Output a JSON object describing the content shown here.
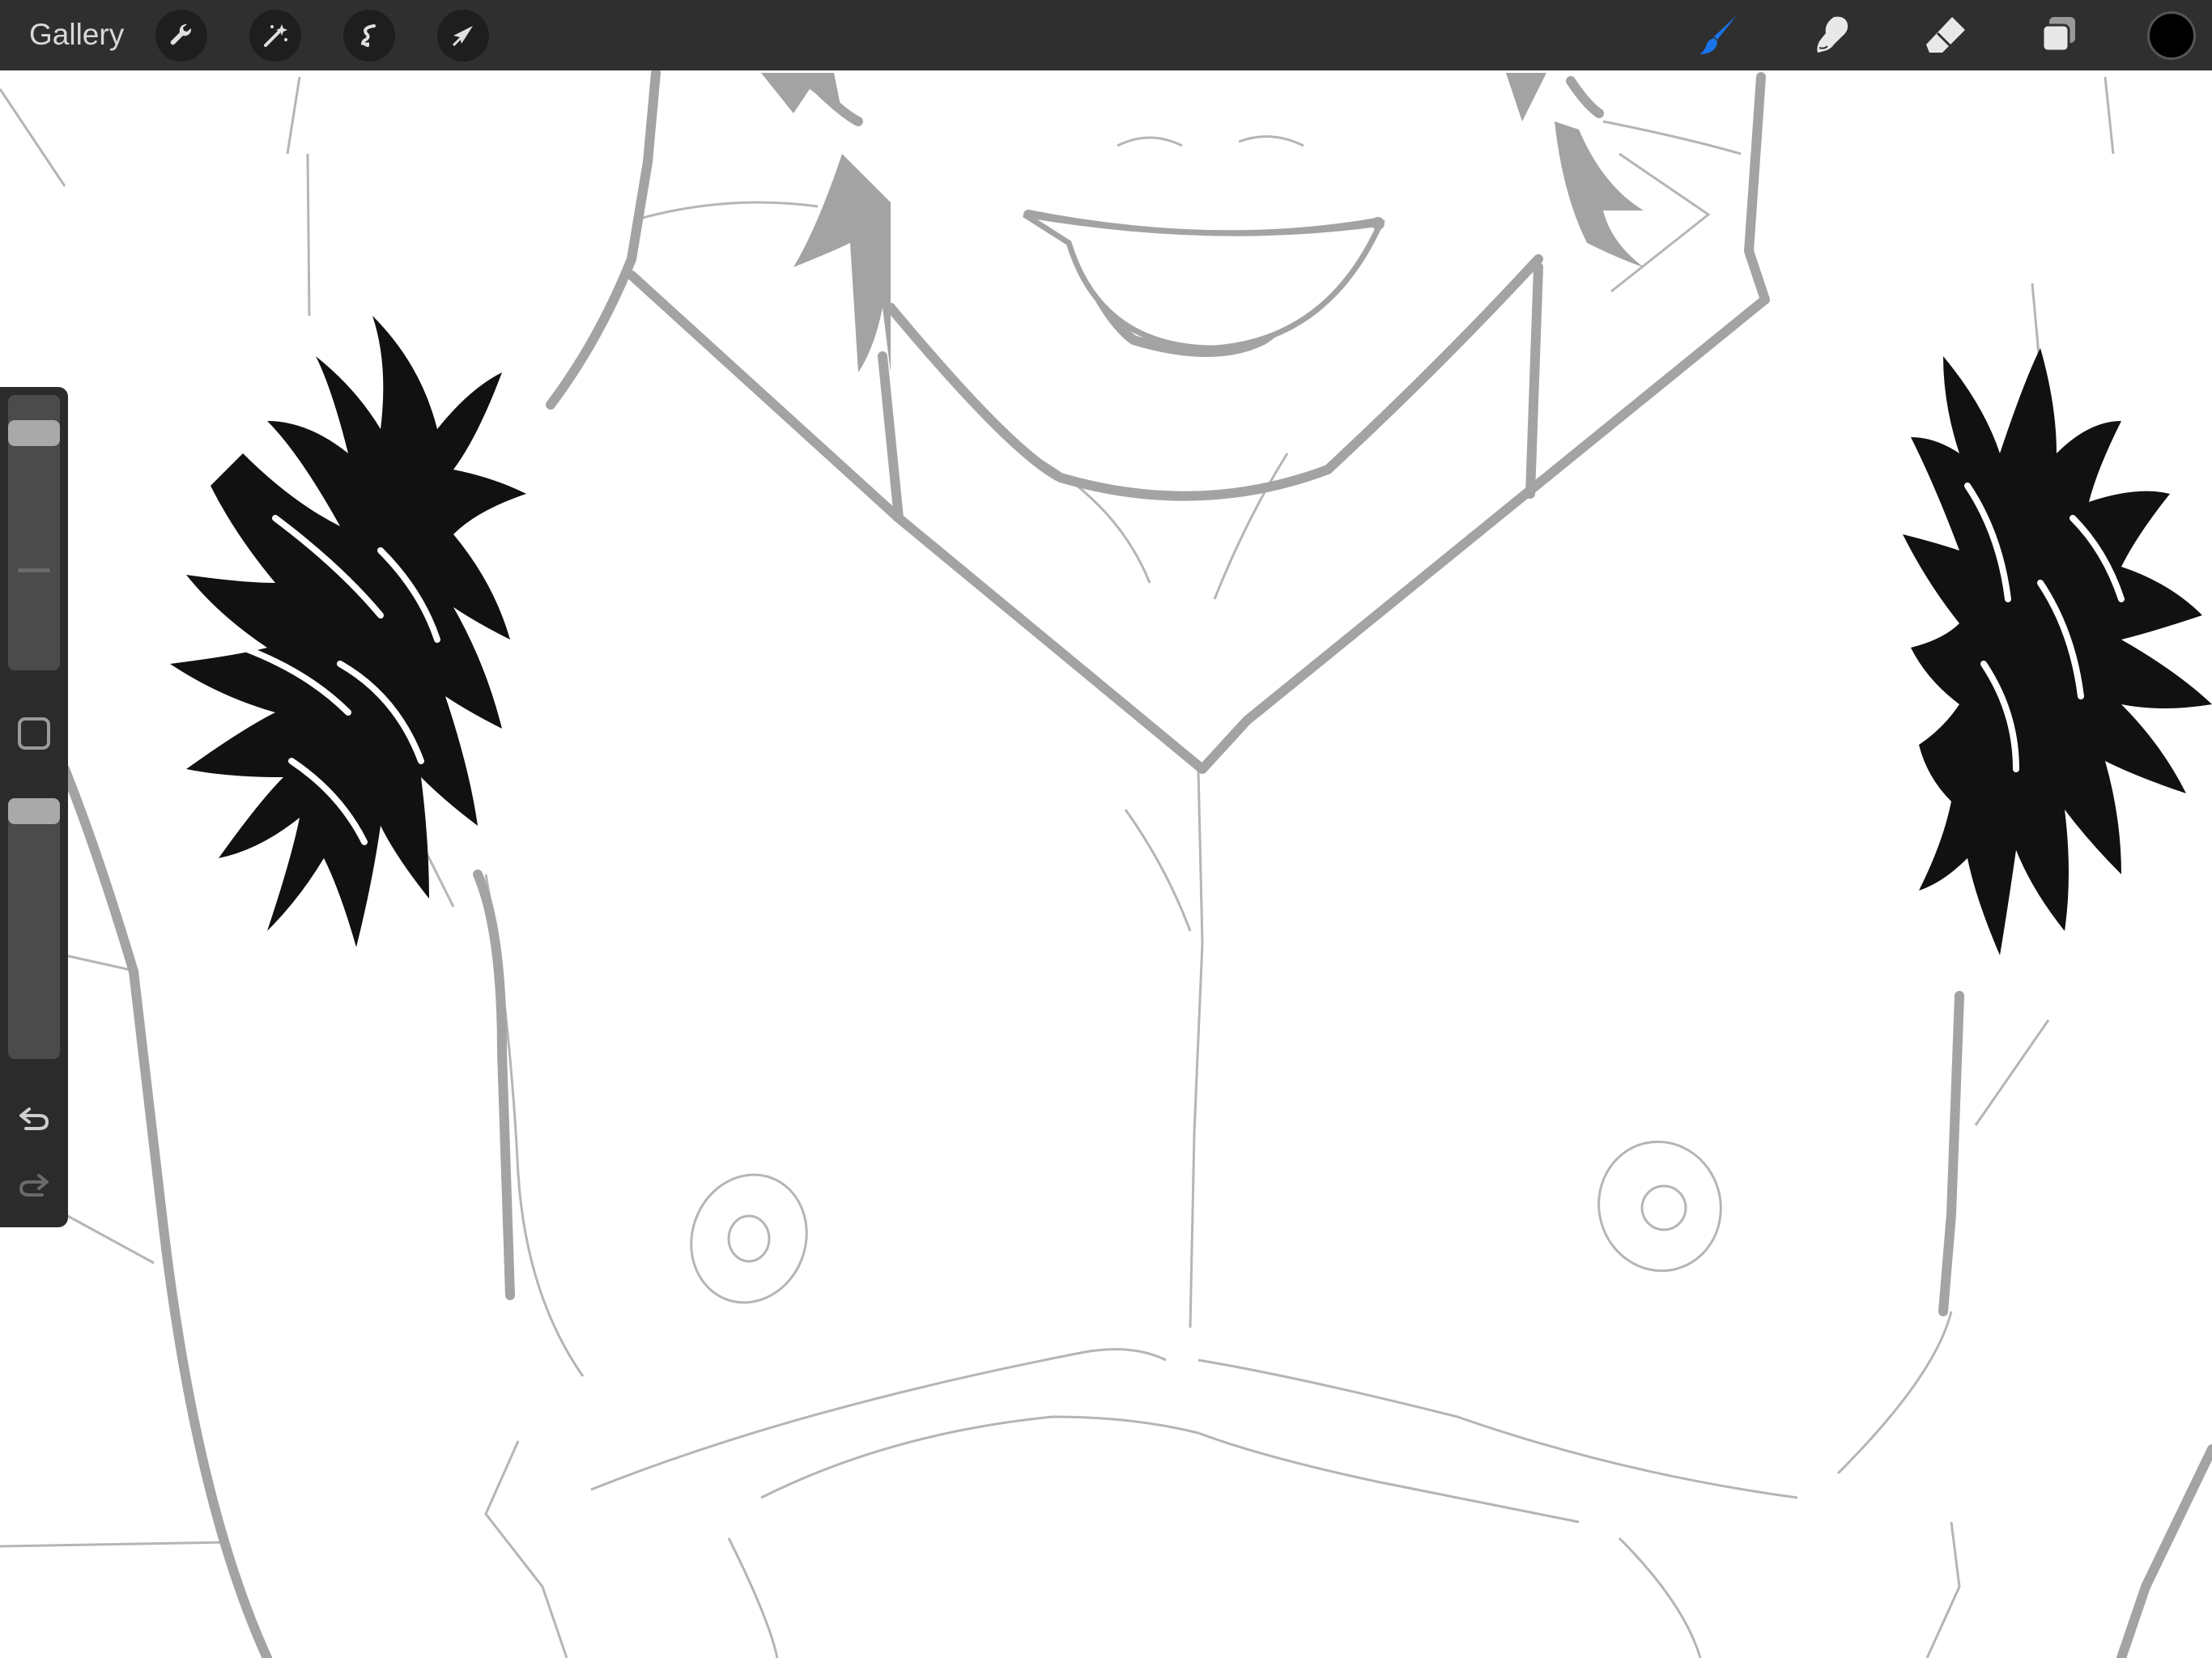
{
  "toolbar": {
    "gallery_label": "Gallery",
    "left_tools": [
      "wrench-icon",
      "magic-wand-icon",
      "selection-icon",
      "transform-arrow-icon"
    ],
    "right_tools": [
      "brush-icon",
      "smudge-icon",
      "eraser-icon",
      "layers-icon"
    ],
    "active_tool": "brush-icon",
    "active_color": "#000000",
    "accent_color": "#1a73e8"
  },
  "sidebar": {
    "brush_size_level": 0.9,
    "opacity_level": 1.0,
    "undo_icon": "undo-icon",
    "redo_icon": "redo-icon"
  }
}
